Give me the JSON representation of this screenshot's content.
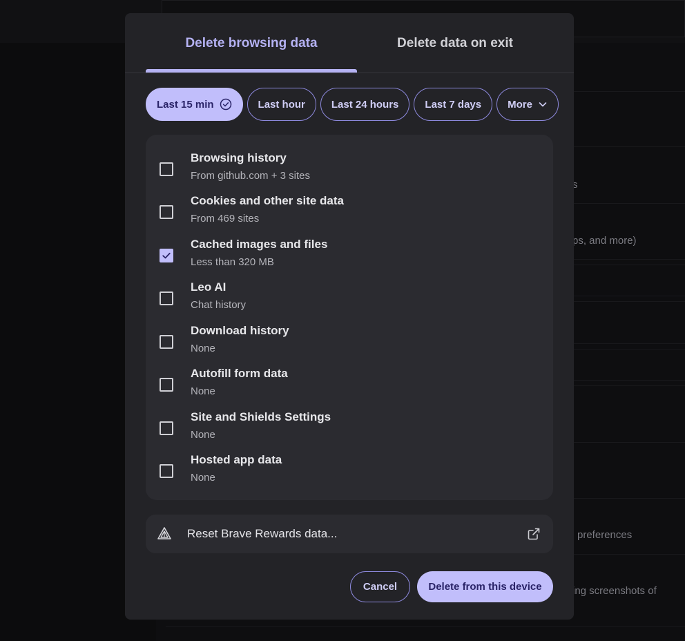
{
  "background": {
    "text_1": "s",
    "text_2": "ps, and more)",
    "text_3": "preferences",
    "text_4": "ing screenshots of"
  },
  "tabs": [
    {
      "label": "Delete browsing data",
      "active": true
    },
    {
      "label": "Delete data on exit",
      "active": false
    }
  ],
  "time_ranges": {
    "selected": "Last 15 min",
    "chips": [
      {
        "label": "Last 15 min",
        "icon": "check-circle-icon"
      },
      {
        "label": "Last hour"
      },
      {
        "label": "Last 24 hours"
      },
      {
        "label": "Last 7 days"
      },
      {
        "label": "More",
        "icon": "chevron-down-icon"
      }
    ]
  },
  "options": [
    {
      "title": "Browsing history",
      "subtitle": "From github.com + 3 sites",
      "checked": false
    },
    {
      "title": "Cookies and other site data",
      "subtitle": "From 469 sites",
      "checked": false
    },
    {
      "title": "Cached images and files",
      "subtitle": "Less than 320 MB",
      "checked": true
    },
    {
      "title": "Leo AI",
      "subtitle": "Chat history",
      "checked": false
    },
    {
      "title": "Download history",
      "subtitle": "None",
      "checked": false
    },
    {
      "title": "Autofill form data",
      "subtitle": "None",
      "checked": false
    },
    {
      "title": "Site and Shields Settings",
      "subtitle": "None",
      "checked": false
    },
    {
      "title": "Hosted app data",
      "subtitle": "None",
      "checked": false
    }
  ],
  "rewards": {
    "label": "Reset Brave Rewards data...",
    "icon": "brave-rewards-icon",
    "trailing_icon": "external-link-icon"
  },
  "buttons": {
    "cancel": "Cancel",
    "delete": "Delete from this device"
  },
  "colors": {
    "accent": "#c1befb",
    "accent_text": "#2a2468",
    "dialog_bg": "#232327",
    "card_bg": "#2b2b30"
  }
}
